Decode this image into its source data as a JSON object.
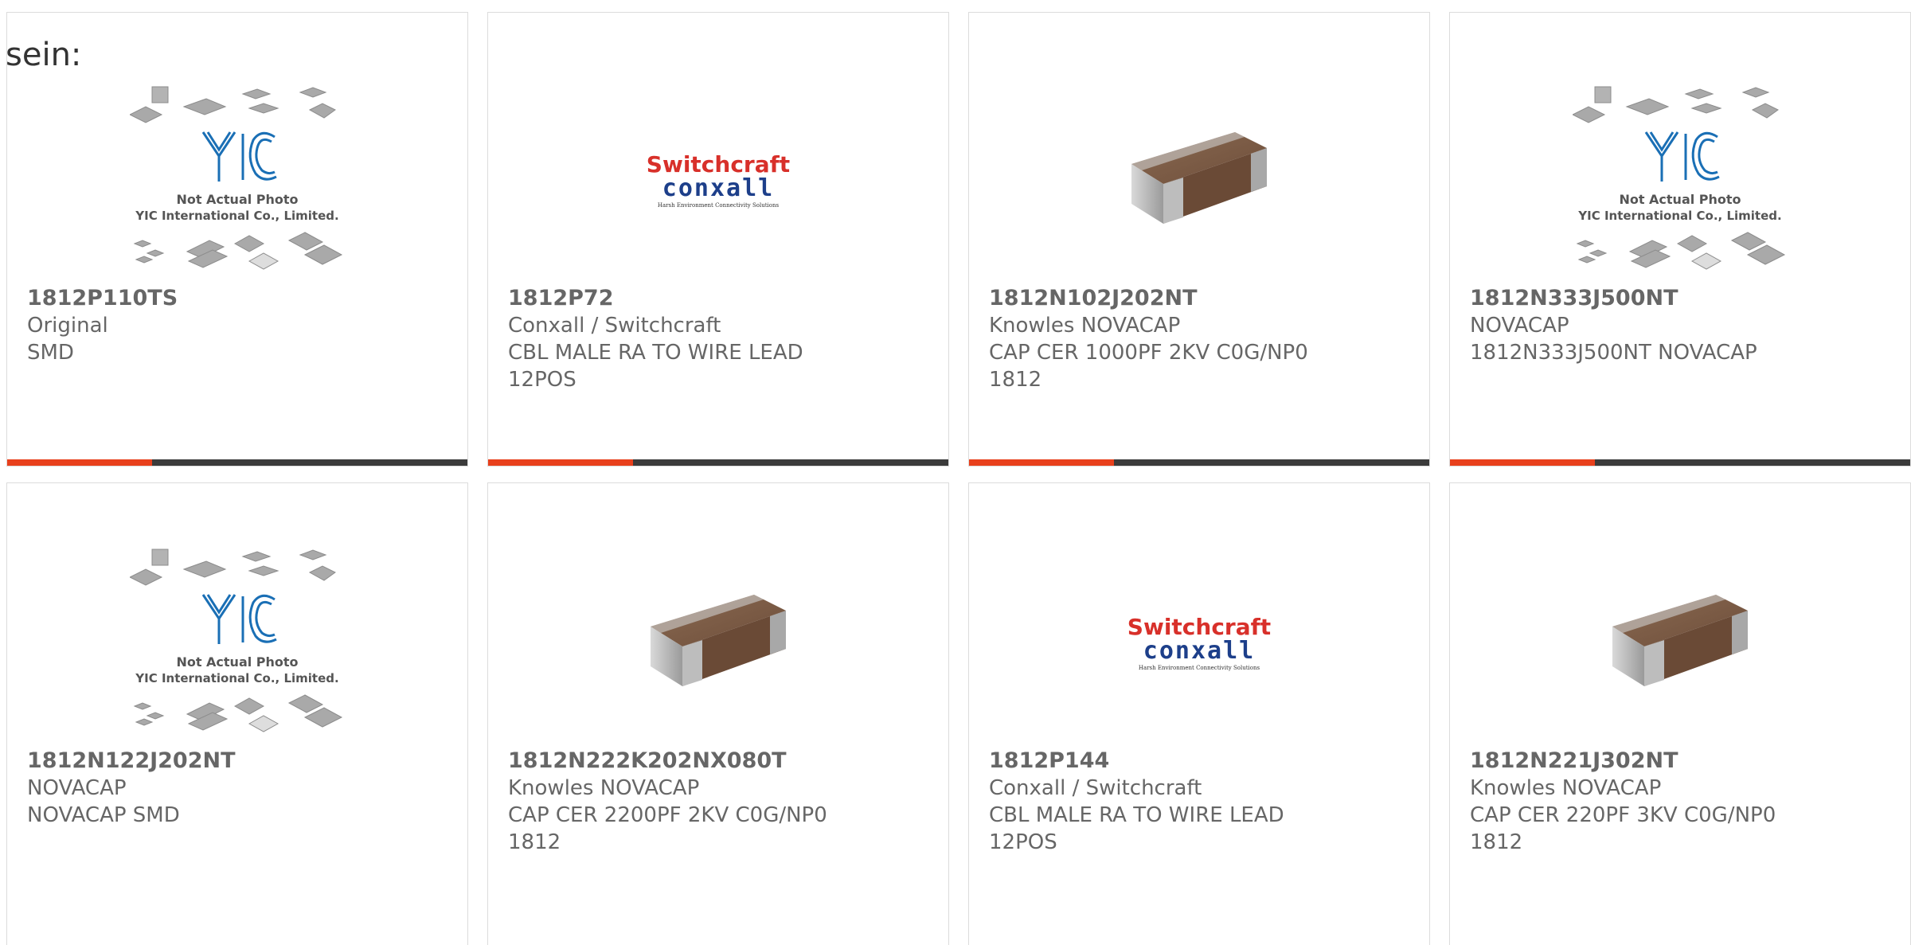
{
  "intro_text": "sein:",
  "placeholders": {
    "yic_line1": "Not Actual Photo",
    "yic_line2": "YIC International Co., Limited.",
    "yic_logo": "YIC",
    "sw_top": "Switchcraft",
    "sw_bottom": "conxall",
    "sw_tagline": "Harsh Environment Connectivity Solutions"
  },
  "colors": {
    "accent": "#e8401c",
    "bar": "#3b3b3b",
    "text": "#666666"
  },
  "products": [
    {
      "part": "1812P110TS",
      "maker": "Original",
      "desc1": "SMD",
      "desc2": "",
      "image": "yic-placeholder"
    },
    {
      "part": "1812P72",
      "maker": "Conxall / Switchcraft",
      "desc1": "CBL MALE RA TO WIRE LEAD",
      "desc2": "12POS",
      "image": "switchcraft-logo"
    },
    {
      "part": "1812N102J202NT",
      "maker": "Knowles NOVACAP",
      "desc1": "CAP CER 1000PF 2KV C0G/NP0",
      "desc2": "1812",
      "image": "capacitor"
    },
    {
      "part": "1812N333J500NT",
      "maker": "NOVACAP",
      "desc1": "1812N333J500NT NOVACAP",
      "desc2": "",
      "image": "yic-placeholder"
    },
    {
      "part": "1812N122J202NT",
      "maker": "NOVACAP",
      "desc1": "NOVACAP SMD",
      "desc2": "",
      "image": "yic-placeholder"
    },
    {
      "part": "1812N222K202NX080T",
      "maker": "Knowles NOVACAP",
      "desc1": "CAP CER 2200PF 2KV C0G/NP0",
      "desc2": "1812",
      "image": "capacitor"
    },
    {
      "part": "1812P144",
      "maker": "Conxall / Switchcraft",
      "desc1": "CBL MALE RA TO WIRE LEAD",
      "desc2": "12POS",
      "image": "switchcraft-logo"
    },
    {
      "part": "1812N221J302NT",
      "maker": "Knowles NOVACAP",
      "desc1": "CAP CER 220PF 3KV C0G/NP0",
      "desc2": "1812",
      "image": "capacitor"
    }
  ]
}
